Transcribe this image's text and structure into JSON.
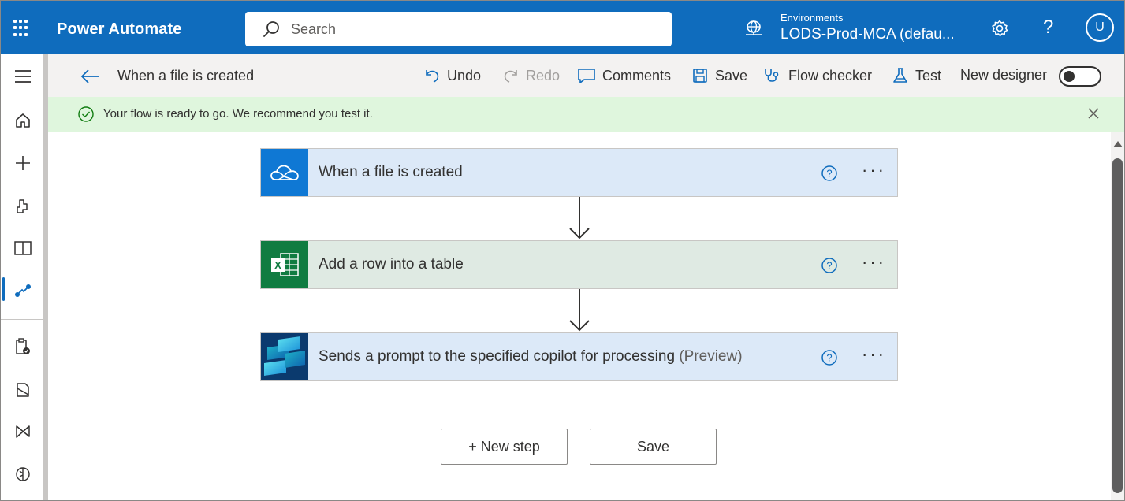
{
  "header": {
    "app_name": "Power Automate",
    "search_placeholder": "Search",
    "environments_label": "Environments",
    "environment_value": "LODS-Prod-MCA (defau...",
    "help_glyph": "?",
    "avatar_initial": "U"
  },
  "commandbar": {
    "flow_title": "When a file is created",
    "undo": "Undo",
    "redo": "Redo",
    "comments": "Comments",
    "save": "Save",
    "flow_checker": "Flow checker",
    "test": "Test",
    "new_designer": "New designer",
    "new_designer_enabled": false
  },
  "banner": {
    "message": "Your flow is ready to go. We recommend you test it."
  },
  "steps": [
    {
      "label": "When a file is created",
      "preview": "",
      "icon": "onedrive-icon",
      "color": "#dce9f8"
    },
    {
      "label": "Add a row into a table",
      "preview": "",
      "icon": "excel-icon",
      "color": "#dfeae3"
    },
    {
      "label": "Sends a prompt to the specified copilot for processing ",
      "preview": "(Preview)",
      "icon": "copilot-studio-icon",
      "color": "#dce9f8"
    }
  ],
  "step_more": "···",
  "buttons": {
    "new_step": "+ New step",
    "save": "Save"
  },
  "colors": {
    "brand": "#0f6cbd",
    "success_banner": "#dff6dd",
    "excel": "#107c41",
    "onedrive": "#0f78d4"
  }
}
